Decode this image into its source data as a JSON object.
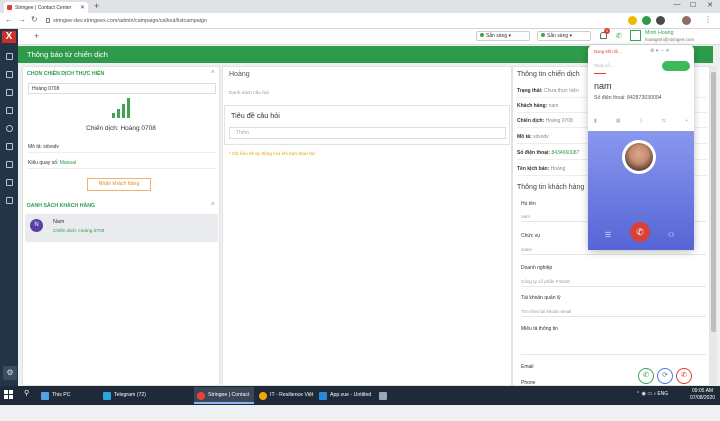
{
  "browser": {
    "tab_title": "Stringee | Contact Center",
    "url": "stringee-dev.stringeex.com/admin/campaign/callout/listcampaign"
  },
  "topbar": {
    "status_1": "Sẵn sàng",
    "status_2": "Sẵn sàng",
    "notif_count": "1",
    "user_name": "Minh Hoang",
    "user_email": "hoangmh@stringee.com"
  },
  "page_title": "Thông báo từ chiến dịch",
  "left": {
    "section1": "CHỌN CHIẾN DỊCH THỰC HIỆN",
    "campaign_select": "Hoàng 0708",
    "campaign_label": "Chiến dịch: Hoàng 0708",
    "desc_label": "Mô tả:",
    "desc_value": "sdvsdv",
    "dial_label": "Kiểu quay số:",
    "dial_value": "Manual",
    "get_customers_btn": "Nhận khách hàng",
    "section2": "DANH SÁCH KHÁCH HÀNG",
    "customers": [
      {
        "initial": "N",
        "name": "Nam",
        "campaign": "Chiến dịch: Hoàng 0708"
      }
    ]
  },
  "middle": {
    "title": "Hoàng",
    "subtitle": "Danh sách câu hỏi",
    "question_title": "Tiêu đề câu hỏi",
    "question_placeholder": "Thêm",
    "note": "* Dữ liệu sẽ tự động lưu khi bạn thao tác"
  },
  "right": {
    "campaign_info_title": "Thông tin chiến dịch",
    "rows": [
      {
        "k": "Trạng thái:",
        "v": "Chưa thực hiện"
      },
      {
        "k": "Khách hàng:",
        "v": "nam"
      },
      {
        "k": "Chiến dịch:",
        "v": "Hoàng 0708"
      },
      {
        "k": "Mô tả:",
        "v": "sdvsdv"
      },
      {
        "k": "Số điện thoại:",
        "v": "8434660087"
      },
      {
        "k": "Tên kịch bản:",
        "v": "Hoàng"
      }
    ],
    "customer_info_title": "Thông tin khách hàng",
    "fields": [
      {
        "label": "Họ tên",
        "value": "nam"
      },
      {
        "label": "Chức vụ",
        "value": "sales"
      },
      {
        "label": "Doanh nghiệp",
        "value": "Công ty cổ phần Fmsoft"
      },
      {
        "label": "Tài khoản quản lý",
        "value": "Tìm theo tài khoản email"
      },
      {
        "label": "Miêu tả thông tin",
        "value": ""
      },
      {
        "label": "Email",
        "value": ""
      },
      {
        "label": "Phone",
        "value": ""
      }
    ]
  },
  "call_widget": {
    "status": "Đang kết nối...",
    "input_placeholder": "Nhập số...",
    "caller_name": "nam",
    "number_label": "Số điện thoại:",
    "number": "842873030094"
  },
  "taskbar": {
    "items": [
      {
        "label": "This PC",
        "color": "#4fa3e0"
      },
      {
        "label": "Telegram (72)",
        "color": "#2aa3df"
      },
      {
        "label": "Stringee | Contact ...",
        "color": "#e94235"
      },
      {
        "label": "IT - Resilience Việt ...",
        "color": "#f2a900"
      },
      {
        "label": "App.vue - Untitled ...",
        "color": "#2b8ad6"
      },
      {
        "label": "",
        "color": "#9aa7b5"
      }
    ],
    "lang": "ENG",
    "time": "09:05 AM",
    "date": "07/08/2020"
  }
}
